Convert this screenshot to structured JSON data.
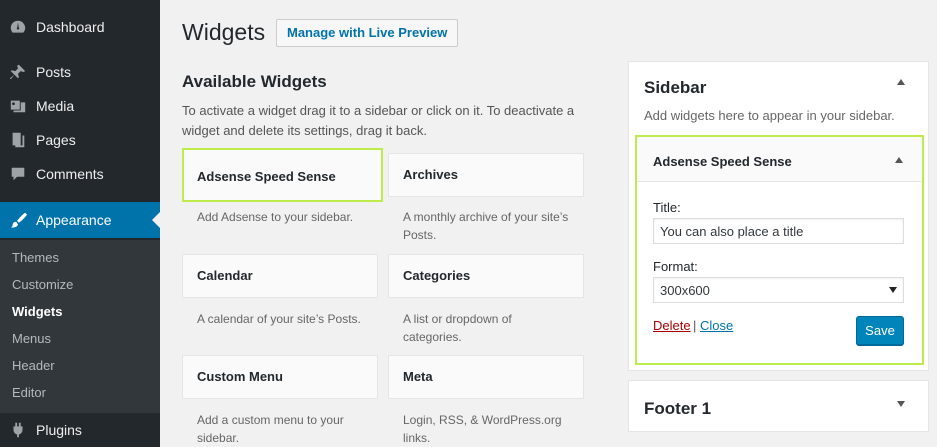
{
  "menu": {
    "dashboard": "Dashboard",
    "posts": "Posts",
    "media": "Media",
    "pages": "Pages",
    "comments": "Comments",
    "appearance": "Appearance",
    "plugins": "Plugins",
    "submenu": [
      "Themes",
      "Customize",
      "Widgets",
      "Menus",
      "Header",
      "Editor"
    ]
  },
  "header": {
    "title": "Widgets",
    "manage_button": "Manage with Live Preview"
  },
  "available": {
    "title": "Available Widgets",
    "description": "To activate a widget drag it to a sidebar or click on it. To deactivate a widget and delete its settings, drag it back.",
    "widgets": [
      {
        "name": "Adsense Speed Sense",
        "desc": "Add Adsense to your sidebar."
      },
      {
        "name": "Archives",
        "desc": "A monthly archive of your site’s Posts."
      },
      {
        "name": "Calendar",
        "desc": "A calendar of your site’s Posts."
      },
      {
        "name": "Categories",
        "desc": "A list or dropdown of categories."
      },
      {
        "name": "Custom Menu",
        "desc": "Add a custom menu to your sidebar."
      },
      {
        "name": "Meta",
        "desc": "Login, RSS, & WordPress.org links."
      }
    ]
  },
  "sidebar": {
    "name": "Sidebar",
    "description": "Add widgets here to appear in your sidebar.",
    "widget": {
      "title": "Adsense Speed Sense",
      "title_label": "Title:",
      "title_value": "You can also place a title",
      "format_label": "Format:",
      "format_value": "300x600",
      "delete_label": "Delete",
      "separator": "|",
      "close_label": "Close",
      "save_label": "Save"
    }
  },
  "footer_area": {
    "name": "Footer 1"
  },
  "colors": {
    "admin_bg": "#23282d",
    "accent": "#0073aa",
    "highlight": "#bfec4d",
    "save_button": "#0085ba"
  }
}
